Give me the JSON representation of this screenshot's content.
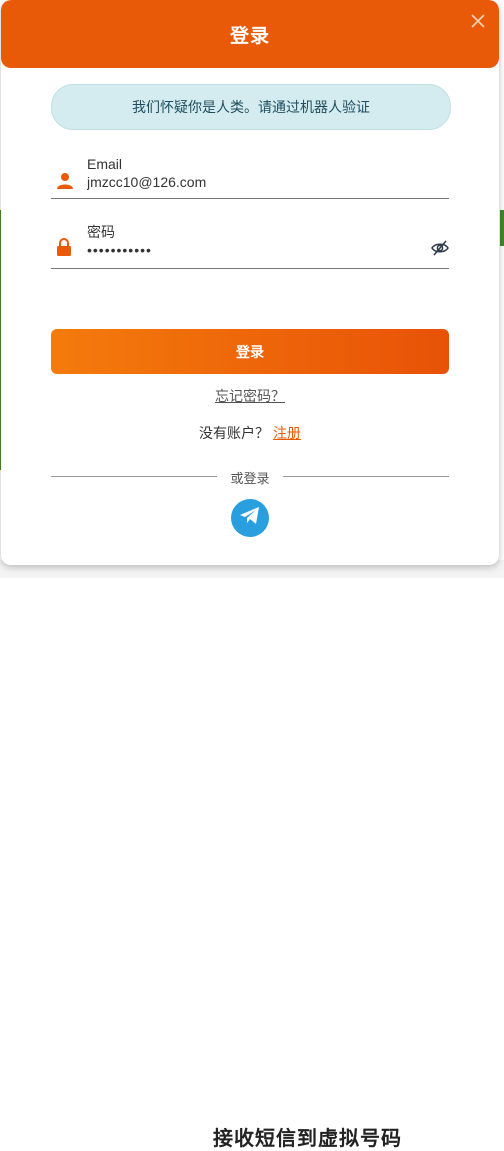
{
  "modal": {
    "title": "登录",
    "close_icon": "close-icon"
  },
  "notice": {
    "text": "我们怀疑你是人类。请通过机器人验证"
  },
  "email_field": {
    "label": "Email",
    "value": "jmzcc10@126.com",
    "icon": "user-icon"
  },
  "password_field": {
    "label": "密码",
    "value": "•••••••••••",
    "icon": "lock-icon",
    "toggle_icon": "eye-slash-icon"
  },
  "login_button": {
    "label": "登录"
  },
  "forgot": {
    "label": "忘记密码？"
  },
  "register": {
    "prompt": "没有账户？",
    "link_label": "注册"
  },
  "divider": {
    "label": "或登录"
  },
  "social": {
    "telegram_icon": "telegram-icon"
  },
  "background": {
    "partial_heading": "接收短信到虚拟号码"
  },
  "colors": {
    "accent": "#e85a08",
    "notice_bg": "#d4ecef",
    "telegram": "#2a9fe0"
  }
}
